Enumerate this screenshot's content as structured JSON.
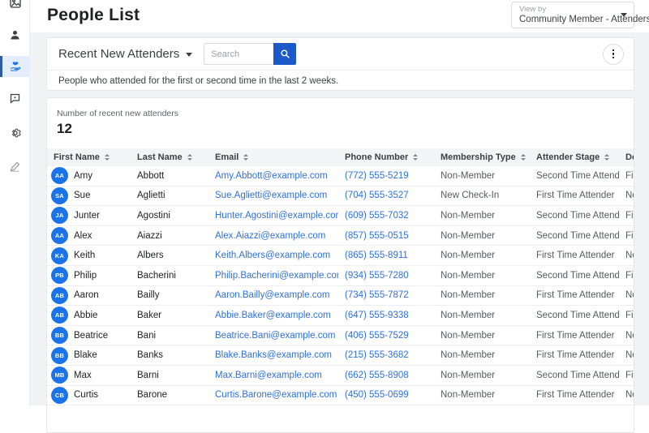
{
  "page": {
    "title": "People List"
  },
  "view_by": {
    "label": "View by",
    "value": "Community Member - Attenders"
  },
  "sidebar": {
    "icons": [
      "image-icon",
      "person-icon",
      "hand-heart-icon",
      "chat-icon",
      "gear-icon",
      "pen-icon"
    ],
    "active_icon": "hand-heart-icon"
  },
  "filter_card": {
    "dropdown_label": "Recent New Attenders",
    "search_placeholder": "Search",
    "description": "People who attended for the first or second time in the last 2 weeks."
  },
  "stat": {
    "label": "Number of recent new attenders",
    "value": "12"
  },
  "table": {
    "columns": [
      {
        "label": "First Name"
      },
      {
        "label": "Last Name"
      },
      {
        "label": "Email"
      },
      {
        "label": "Phone Number"
      },
      {
        "label": "Membership Type"
      },
      {
        "label": "Attender Stage"
      },
      {
        "label": "Donor Stage"
      }
    ],
    "rows": [
      {
        "initials": "AA",
        "first": "Amy",
        "last": "Abbott",
        "email": "Amy.Abbott@example.com",
        "phone": "(772) 555-5219",
        "membership": "Non-Member",
        "attender": "Second Time Attender",
        "donor": "First Time Donor"
      },
      {
        "initials": "SA",
        "first": "Sue",
        "last": "Aglietti",
        "email": "Sue.Aglietti@example.com",
        "phone": "(704) 555-3527",
        "membership": "New Check-In",
        "attender": "First Time Attender",
        "donor": "Non-Donor"
      },
      {
        "initials": "JA",
        "first": "Junter",
        "last": "Agostini",
        "email": "Hunter.Agostini@example.com",
        "phone": "(609) 555-7032",
        "membership": "Non-Member",
        "attender": "Second Time Attender",
        "donor": "First Time Donor"
      },
      {
        "initials": "AA",
        "first": "Alex",
        "last": "Aiazzi",
        "email": "Alex.Aiazzi@example.com",
        "phone": "(857) 555-0515",
        "membership": "Non-Member",
        "attender": "Second Time Attender",
        "donor": "First Time Donor"
      },
      {
        "initials": "KA",
        "first": "Keith",
        "last": "Albers",
        "email": "Keith.Albers@example.com",
        "phone": "(865) 555-8911",
        "membership": "Non-Member",
        "attender": "First Time Attender",
        "donor": "Non-Donor"
      },
      {
        "initials": "PB",
        "first": "Philip",
        "last": "Bacherini",
        "email": "Philip.Bacherini@example.com",
        "phone": "(934) 555-7280",
        "membership": "Non-Member",
        "attender": "Second Time Attender",
        "donor": "First Time Donor"
      },
      {
        "initials": "AB",
        "first": "Aaron",
        "last": "Bailly",
        "email": "Aaron.Bailly@example.com",
        "phone": "(734) 555-7872",
        "membership": "Non-Member",
        "attender": "First Time Attender",
        "donor": "Non-Donor"
      },
      {
        "initials": "AB",
        "first": "Abbie",
        "last": "Baker",
        "email": "Abbie.Baker@example.com",
        "phone": "(647) 555-9338",
        "membership": "Non-Member",
        "attender": "Second Time Attender",
        "donor": "First Time Donor"
      },
      {
        "initials": "BB",
        "first": "Beatrice",
        "last": "Bani",
        "email": "Beatrice.Bani@example.com",
        "phone": "(406) 555-7529",
        "membership": "Non-Member",
        "attender": "First Time Attender",
        "donor": "Non-Donor"
      },
      {
        "initials": "BB",
        "first": "Blake",
        "last": "Banks",
        "email": "Blake.Banks@example.com",
        "phone": "(215) 555-3682",
        "membership": "Non-Member",
        "attender": "First Time Attender",
        "donor": "Non-Donor"
      },
      {
        "initials": "MB",
        "first": "Max",
        "last": "Barni",
        "email": "Max.Barni@example.com",
        "phone": "(662) 555-8908",
        "membership": "Non-Member",
        "attender": "Second Time Attender",
        "donor": "First Time Donor"
      },
      {
        "initials": "CB",
        "first": "Curtis",
        "last": "Barone",
        "email": "Curtis.Barone@example.com",
        "phone": "(450) 555-0699",
        "membership": "Non-Member",
        "attender": "First Time Attender",
        "donor": "Non-Donor"
      }
    ]
  },
  "colors": {
    "accent_blue": "#1d58c9",
    "avatar_blue": "#1a73e8",
    "link_blue": "#2e6fe0",
    "sidebar_active_bg": "#e4edfb",
    "table_header_bg": "#f3f4f6",
    "page_bg": "#f1f3f4"
  }
}
